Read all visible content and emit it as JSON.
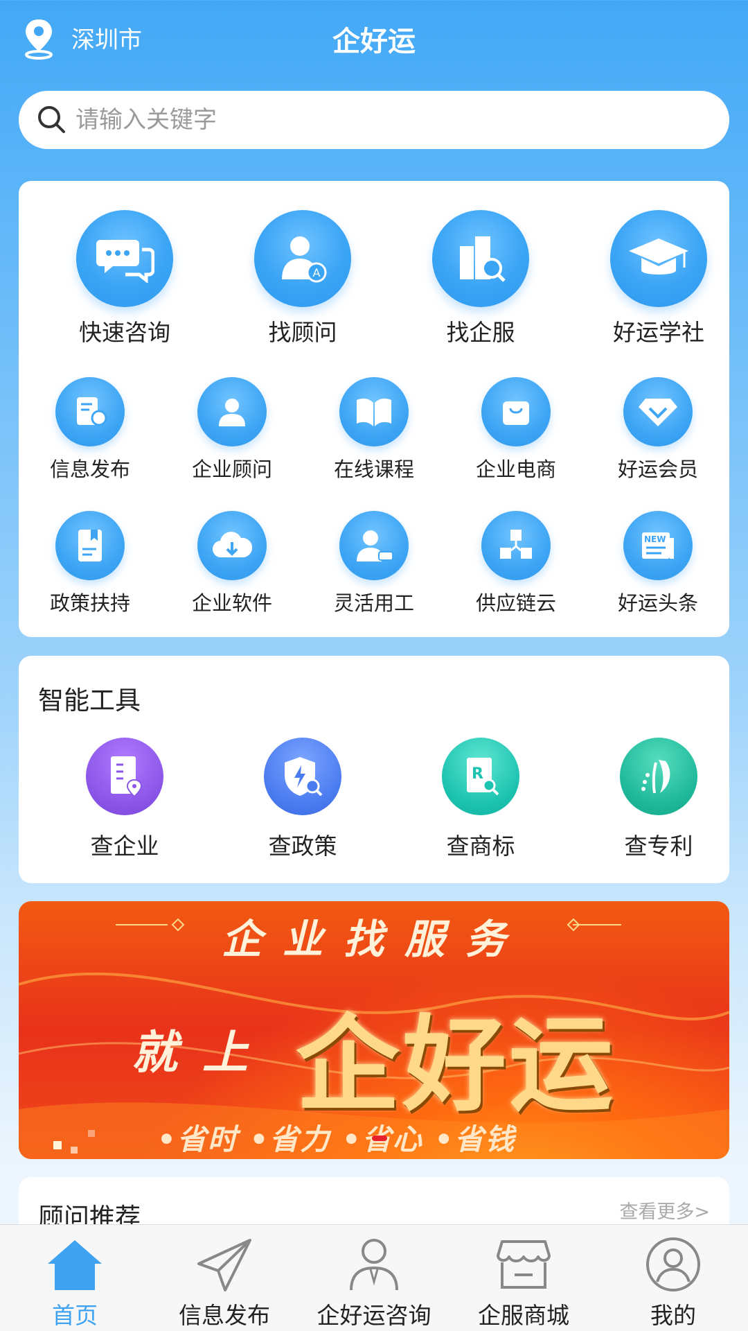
{
  "header": {
    "city": "深圳市",
    "title": "企好运"
  },
  "search": {
    "placeholder": "请输入关键字"
  },
  "main_menu": {
    "big": [
      {
        "label": "快速咨询",
        "icon": "chat-bubbles-icon"
      },
      {
        "label": "找顾问",
        "icon": "advisor-icon"
      },
      {
        "label": "找企服",
        "icon": "building-search-icon"
      },
      {
        "label": "好运学社",
        "icon": "graduation-cap-icon"
      }
    ],
    "row2": [
      {
        "label": "信息发布",
        "icon": "document-send-icon"
      },
      {
        "label": "企业顾问",
        "icon": "person-icon"
      },
      {
        "label": "在线课程",
        "icon": "open-book-icon"
      },
      {
        "label": "企业电商",
        "icon": "shopping-bag-icon"
      },
      {
        "label": "好运会员",
        "icon": "diamond-icon"
      }
    ],
    "row3": [
      {
        "label": "政策扶持",
        "icon": "bookmark-doc-icon"
      },
      {
        "label": "企业软件",
        "icon": "cloud-download-icon"
      },
      {
        "label": "灵活用工",
        "icon": "worker-icon"
      },
      {
        "label": "供应链云",
        "icon": "cubes-icon"
      },
      {
        "label": "好运头条",
        "icon": "news-icon"
      }
    ]
  },
  "tools": {
    "title": "智能工具",
    "items": [
      {
        "label": "查企业",
        "icon": "company-location-icon",
        "color": "#8B55E8"
      },
      {
        "label": "查政策",
        "icon": "shield-search-icon",
        "color": "#4B7BF0"
      },
      {
        "label": "查商标",
        "icon": "trademark-icon",
        "color": "#1CC3B0"
      },
      {
        "label": "查专利",
        "icon": "patent-icon",
        "color": "#1FB89A"
      }
    ]
  },
  "banner": {
    "headline": "企业找服务",
    "prefix": "就上",
    "brand": "企好运",
    "slogan": "•省时 •省力 •省心 •省钱"
  },
  "recommend": {
    "title": "顾问推荐",
    "more": "查看更多>"
  },
  "tabbar": {
    "items": [
      {
        "label": "首页",
        "icon": "home-icon",
        "active": true
      },
      {
        "label": "信息发布",
        "icon": "paper-plane-icon"
      },
      {
        "label": "企好运咨询",
        "icon": "consultant-icon"
      },
      {
        "label": "企服商城",
        "icon": "store-icon"
      },
      {
        "label": "我的",
        "icon": "profile-icon"
      }
    ],
    "active_color": "#3FA3F2"
  }
}
